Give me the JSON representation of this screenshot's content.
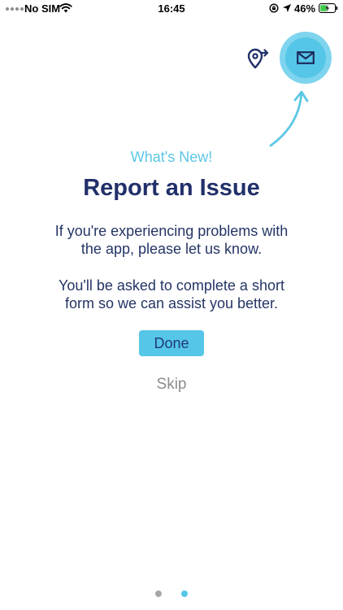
{
  "status_bar": {
    "carrier": "No SIM",
    "time": "16:45",
    "battery": "46%",
    "battery_level": 0.46
  },
  "colors": {
    "accent": "#55c6e8",
    "title": "#21306a",
    "muted": "#8c8c8c"
  },
  "tour": {
    "highlighted_icon": "mail-icon",
    "secondary_icon": "map-pin-arrow-icon"
  },
  "content": {
    "eyebrow": "What's New!",
    "title": "Report an Issue",
    "paragraph_1_line_1": "If you're experiencing problems with",
    "paragraph_1_line_2": "the app, please let us know.",
    "paragraph_2_line_1": "You'll be asked to complete a short",
    "paragraph_2_line_2": "form so we can assist you better."
  },
  "actions": {
    "done_label": "Done",
    "skip_label": "Skip"
  },
  "pagination": {
    "total": 2,
    "current": 2
  }
}
